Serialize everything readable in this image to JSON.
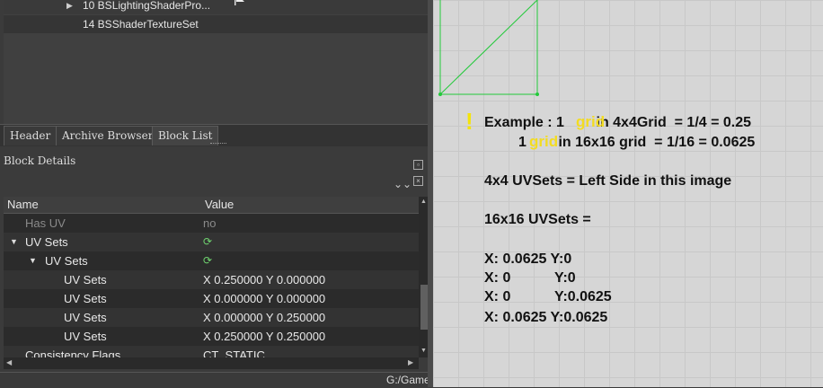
{
  "tree": {
    "items": [
      {
        "label": "10 BSLightingShaderPro..."
      },
      {
        "label": "14 BSShaderTextureSet"
      }
    ]
  },
  "tabs": [
    {
      "label": "Header"
    },
    {
      "label": "Archive Browser"
    },
    {
      "label": "Block List"
    }
  ],
  "block_details": {
    "title": "Block Details",
    "columns": {
      "name": "Name",
      "value": "Value"
    },
    "rows": [
      {
        "name": "Has UV",
        "value": "no"
      },
      {
        "name": "UV Sets",
        "value": ""
      },
      {
        "name": "UV Sets",
        "value": ""
      },
      {
        "name": "UV Sets",
        "value": "X 0.250000 Y 0.000000"
      },
      {
        "name": "UV Sets",
        "value": "X 0.000000 Y 0.000000"
      },
      {
        "name": "UV Sets",
        "value": "X 0.000000 Y 0.250000"
      },
      {
        "name": "UV Sets",
        "value": "X 0.250000 Y 0.250000"
      },
      {
        "name": "Consistency Flags",
        "value": "CT_STATIC"
      }
    ]
  },
  "status": {
    "text": "G:/Game"
  },
  "annotation": {
    "exclamation": "!",
    "line1": "Example : 1        in 4x4Grid  = 1/4 = 0.25",
    "line2": "1        in 16x16 grid  = 1/16 = 0.0625",
    "grid_word": "grid",
    "left_side": "4x4 UVSets = Left Side in this image",
    "uvsets16": "16x16 UVSets =",
    "coords": [
      "X: 0.0625 Y:0",
      "X: 0           Y:0",
      "X: 0           Y:0.0625",
      "X: 0.0625 Y:0.0625"
    ]
  },
  "colors": {
    "uv_line": "#22c93a",
    "highlight": "#f3dc21",
    "refresh_icon": "#6fd36f"
  },
  "icons": {
    "refresh": "refresh-icon",
    "flag": "flag-icon",
    "collapse": "double-chevron-down-icon"
  }
}
